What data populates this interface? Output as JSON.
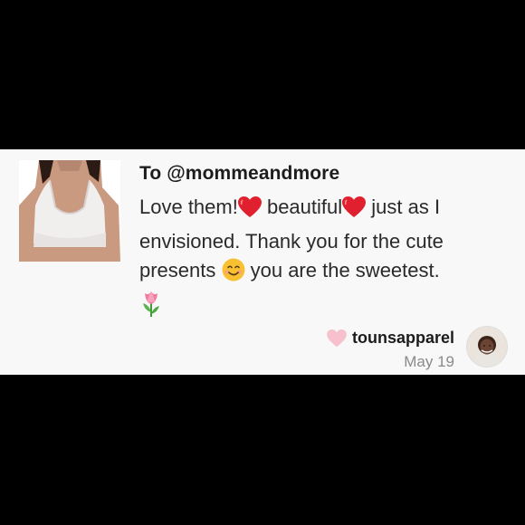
{
  "review": {
    "to_line": "To @mommeandmore",
    "message_line1_a": "Love them!",
    "message_line1_b": " beautiful",
    "message_line1_c": " just as I",
    "message_line2": "envisioned. Thank you for the cute",
    "message_line3_a": "presents ",
    "message_line3_b": " you are the sweetest.",
    "emojis": [
      "red-heart",
      "red-heart",
      "smiling-face",
      "tulip"
    ]
  },
  "footer": {
    "username": "tounsapparel",
    "date": "May 19",
    "heart_color": "#f6c1cc"
  },
  "colors": {
    "background": "#000000",
    "card": "#f9f8f8",
    "heart_emoji": "#e0202e"
  }
}
